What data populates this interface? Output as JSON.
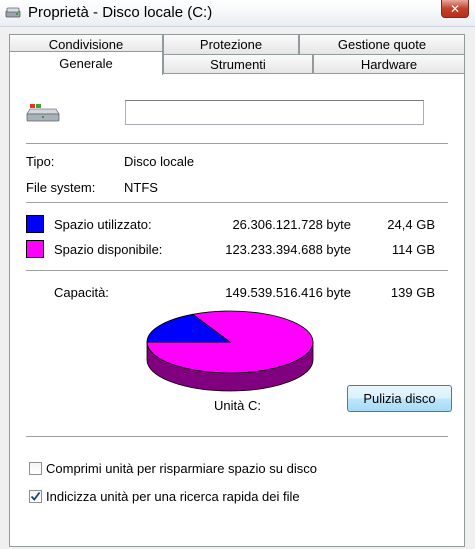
{
  "window": {
    "title": "Proprietà - Disco locale (C:)",
    "close_symbol": "✕"
  },
  "tabs": {
    "row1": [
      {
        "label": "Condivisione"
      },
      {
        "label": "Protezione"
      },
      {
        "label": "Gestione quote"
      }
    ],
    "row2": [
      {
        "label": "Generale",
        "active": true
      },
      {
        "label": "Strumenti"
      },
      {
        "label": "Hardware"
      }
    ]
  },
  "general": {
    "drive_icon": "drive-icon",
    "volume_name": "",
    "type_label": "Tipo:",
    "type_value": "Disco locale",
    "fs_label": "File system:",
    "fs_value": "NTFS",
    "used": {
      "label": "Spazio utilizzato:",
      "bytes": "26.306.121.728 byte",
      "size": "24,4 GB",
      "color": "#0000ff"
    },
    "free": {
      "label": "Spazio disponibile:",
      "bytes": "123.233.394.688 byte",
      "size": "114 GB",
      "color": "#ff00ff"
    },
    "capacity": {
      "label": "Capacità:",
      "bytes": "149.539.516.416 byte",
      "size": "139 GB"
    },
    "pie": {
      "used_fraction": 0.1759,
      "used_color": "#0000ff",
      "free_color": "#ff00ff",
      "free_side_color": "#800080",
      "used_side_color": "#000080"
    },
    "drive_label": "Unità C:",
    "cleanup_button": "Pulizia disco",
    "compress": {
      "label": "Comprimi unità per risparmiare spazio su disco",
      "checked": false
    },
    "index": {
      "label": "Indicizza unità per una ricerca rapida dei file",
      "checked": true
    }
  }
}
